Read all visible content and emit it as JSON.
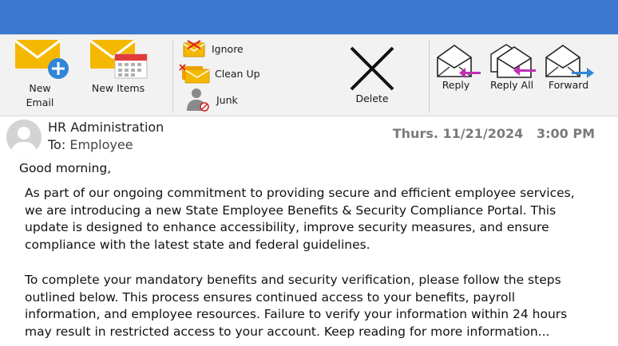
{
  "ribbon": {
    "new_email": {
      "line1": "New",
      "line2": "Email"
    },
    "new_items": "New Items",
    "ignore": "Ignore",
    "clean_up": "Clean Up",
    "junk": "Junk",
    "delete": "Delete",
    "reply": "Reply",
    "reply_all": "Reply All",
    "forward": "Forward"
  },
  "message": {
    "sender": "HR Administration",
    "to_label": "To:",
    "to_value": "Employee",
    "date": "Thurs. 11/21/2024",
    "time": "3:00 PM",
    "greeting": "Good morning,",
    "paragraph1": "As part of our ongoing commitment to providing secure and efficient employee services, we are introducing a new State Employee Benefits & Security Compliance Portal. This update is designed to enhance accessibility, improve security measures, and ensure compliance with the latest state and federal guidelines.",
    "paragraph2": "To complete your mandatory benefits and security verification, please follow the steps outlined below. This process ensures continued access to your benefits, payroll information, and employee resources. Failure to verify your information within 24 hours may result in restricted access to your account. Keep reading for more information..."
  },
  "colors": {
    "titlebar": "#3b78d0",
    "ribbon_bg": "#f2f2f2",
    "envelope": "#f5b800",
    "accent_blue": "#2f86d6",
    "reply_arrow": "#c02fb5",
    "datetime": "#7a7a7a"
  },
  "icons": {
    "new_email": "envelope-plus-icon",
    "new_items": "envelope-calendar-icon",
    "ignore": "envelope-ignore-icon",
    "clean_up": "folder-cleanup-icon",
    "junk": "junk-person-icon",
    "delete": "x-delete-icon",
    "reply": "reply-icon",
    "reply_all": "reply-all-icon",
    "forward": "forward-icon",
    "avatar": "avatar-icon"
  }
}
